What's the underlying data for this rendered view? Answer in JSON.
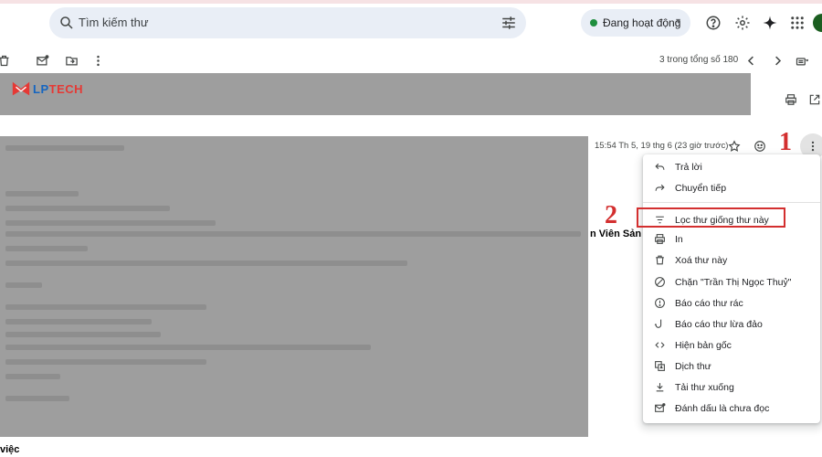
{
  "search": {
    "placeholder": "Tìm kiếm thư"
  },
  "status": {
    "label": "Đang hoạt động",
    "color": "#1e8e3e"
  },
  "top_icons": [
    "search-icon",
    "tune-icon",
    "help-icon",
    "settings-icon",
    "sparkle-icon",
    "apps-icon"
  ],
  "toolbar": {
    "count": "3 trong tổng số 180",
    "icons": [
      "delete-icon",
      "mark-unread-icon",
      "move-to-icon",
      "more-vert-icon",
      "chevron-left-icon",
      "chevron-right-icon",
      "keyboard-icon"
    ]
  },
  "logo": {
    "prefix": "LP",
    "suffix": "TECH"
  },
  "email": {
    "time": "15:54 Th 5, 19 thg 6 (23 giờ trước)",
    "peek_right": "n Viên Sản T",
    "peek_bottom": "việc"
  },
  "markers": {
    "one": "1",
    "two": "2"
  },
  "menu": {
    "items": [
      {
        "label": "Trả lời",
        "icon": "reply-icon"
      },
      {
        "label": "Chuyển tiếp",
        "icon": "forward-icon"
      },
      {
        "label": "Lọc thư giống thư này",
        "icon": "filter-icon",
        "highlighted": true
      },
      {
        "label": "In",
        "icon": "print-icon"
      },
      {
        "label": "Xoá thư này",
        "icon": "trash-icon"
      },
      {
        "label": "Chặn \"Trần Thị Ngọc Thuỷ\"",
        "icon": "block-icon"
      },
      {
        "label": "Báo cáo thư rác",
        "icon": "report-spam-icon"
      },
      {
        "label": "Báo cáo thư lừa đảo",
        "icon": "phishing-icon"
      },
      {
        "label": "Hiện bản gốc",
        "icon": "code-icon"
      },
      {
        "label": "Dịch thư",
        "icon": "translate-icon"
      },
      {
        "label": "Tải thư xuống",
        "icon": "download-icon"
      },
      {
        "label": "Đánh dấu là chưa đọc",
        "icon": "mark-unread-icon"
      }
    ]
  },
  "colors": {
    "accent_red": "#d32f2f",
    "menu_bg": "#ffffff",
    "search_bg": "#e9eef6"
  }
}
